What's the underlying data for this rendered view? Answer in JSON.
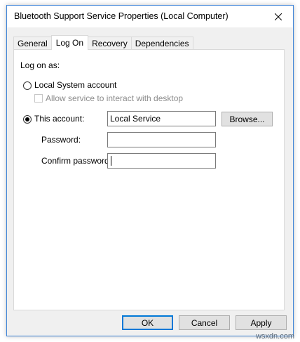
{
  "window": {
    "title": "Bluetooth Support Service Properties (Local Computer)",
    "close_icon": "close-icon"
  },
  "tabs": [
    {
      "label": "General",
      "active": false
    },
    {
      "label": "Log On",
      "active": true
    },
    {
      "label": "Recovery",
      "active": false
    },
    {
      "label": "Dependencies",
      "active": false
    }
  ],
  "logon": {
    "heading": "Log on as:",
    "local_system_label": "Local System account",
    "local_system_selected": false,
    "interact_label": "Allow service to interact with desktop",
    "interact_checked": false,
    "this_account_label": "This account:",
    "this_account_selected": true,
    "account_value": "Local Service",
    "browse_label": "Browse...",
    "password_label": "Password:",
    "password_value": "",
    "confirm_label": "Confirm password:",
    "confirm_value": ""
  },
  "buttons": {
    "ok": "OK",
    "cancel": "Cancel",
    "apply": "Apply"
  },
  "watermark": "wsxdn.com"
}
